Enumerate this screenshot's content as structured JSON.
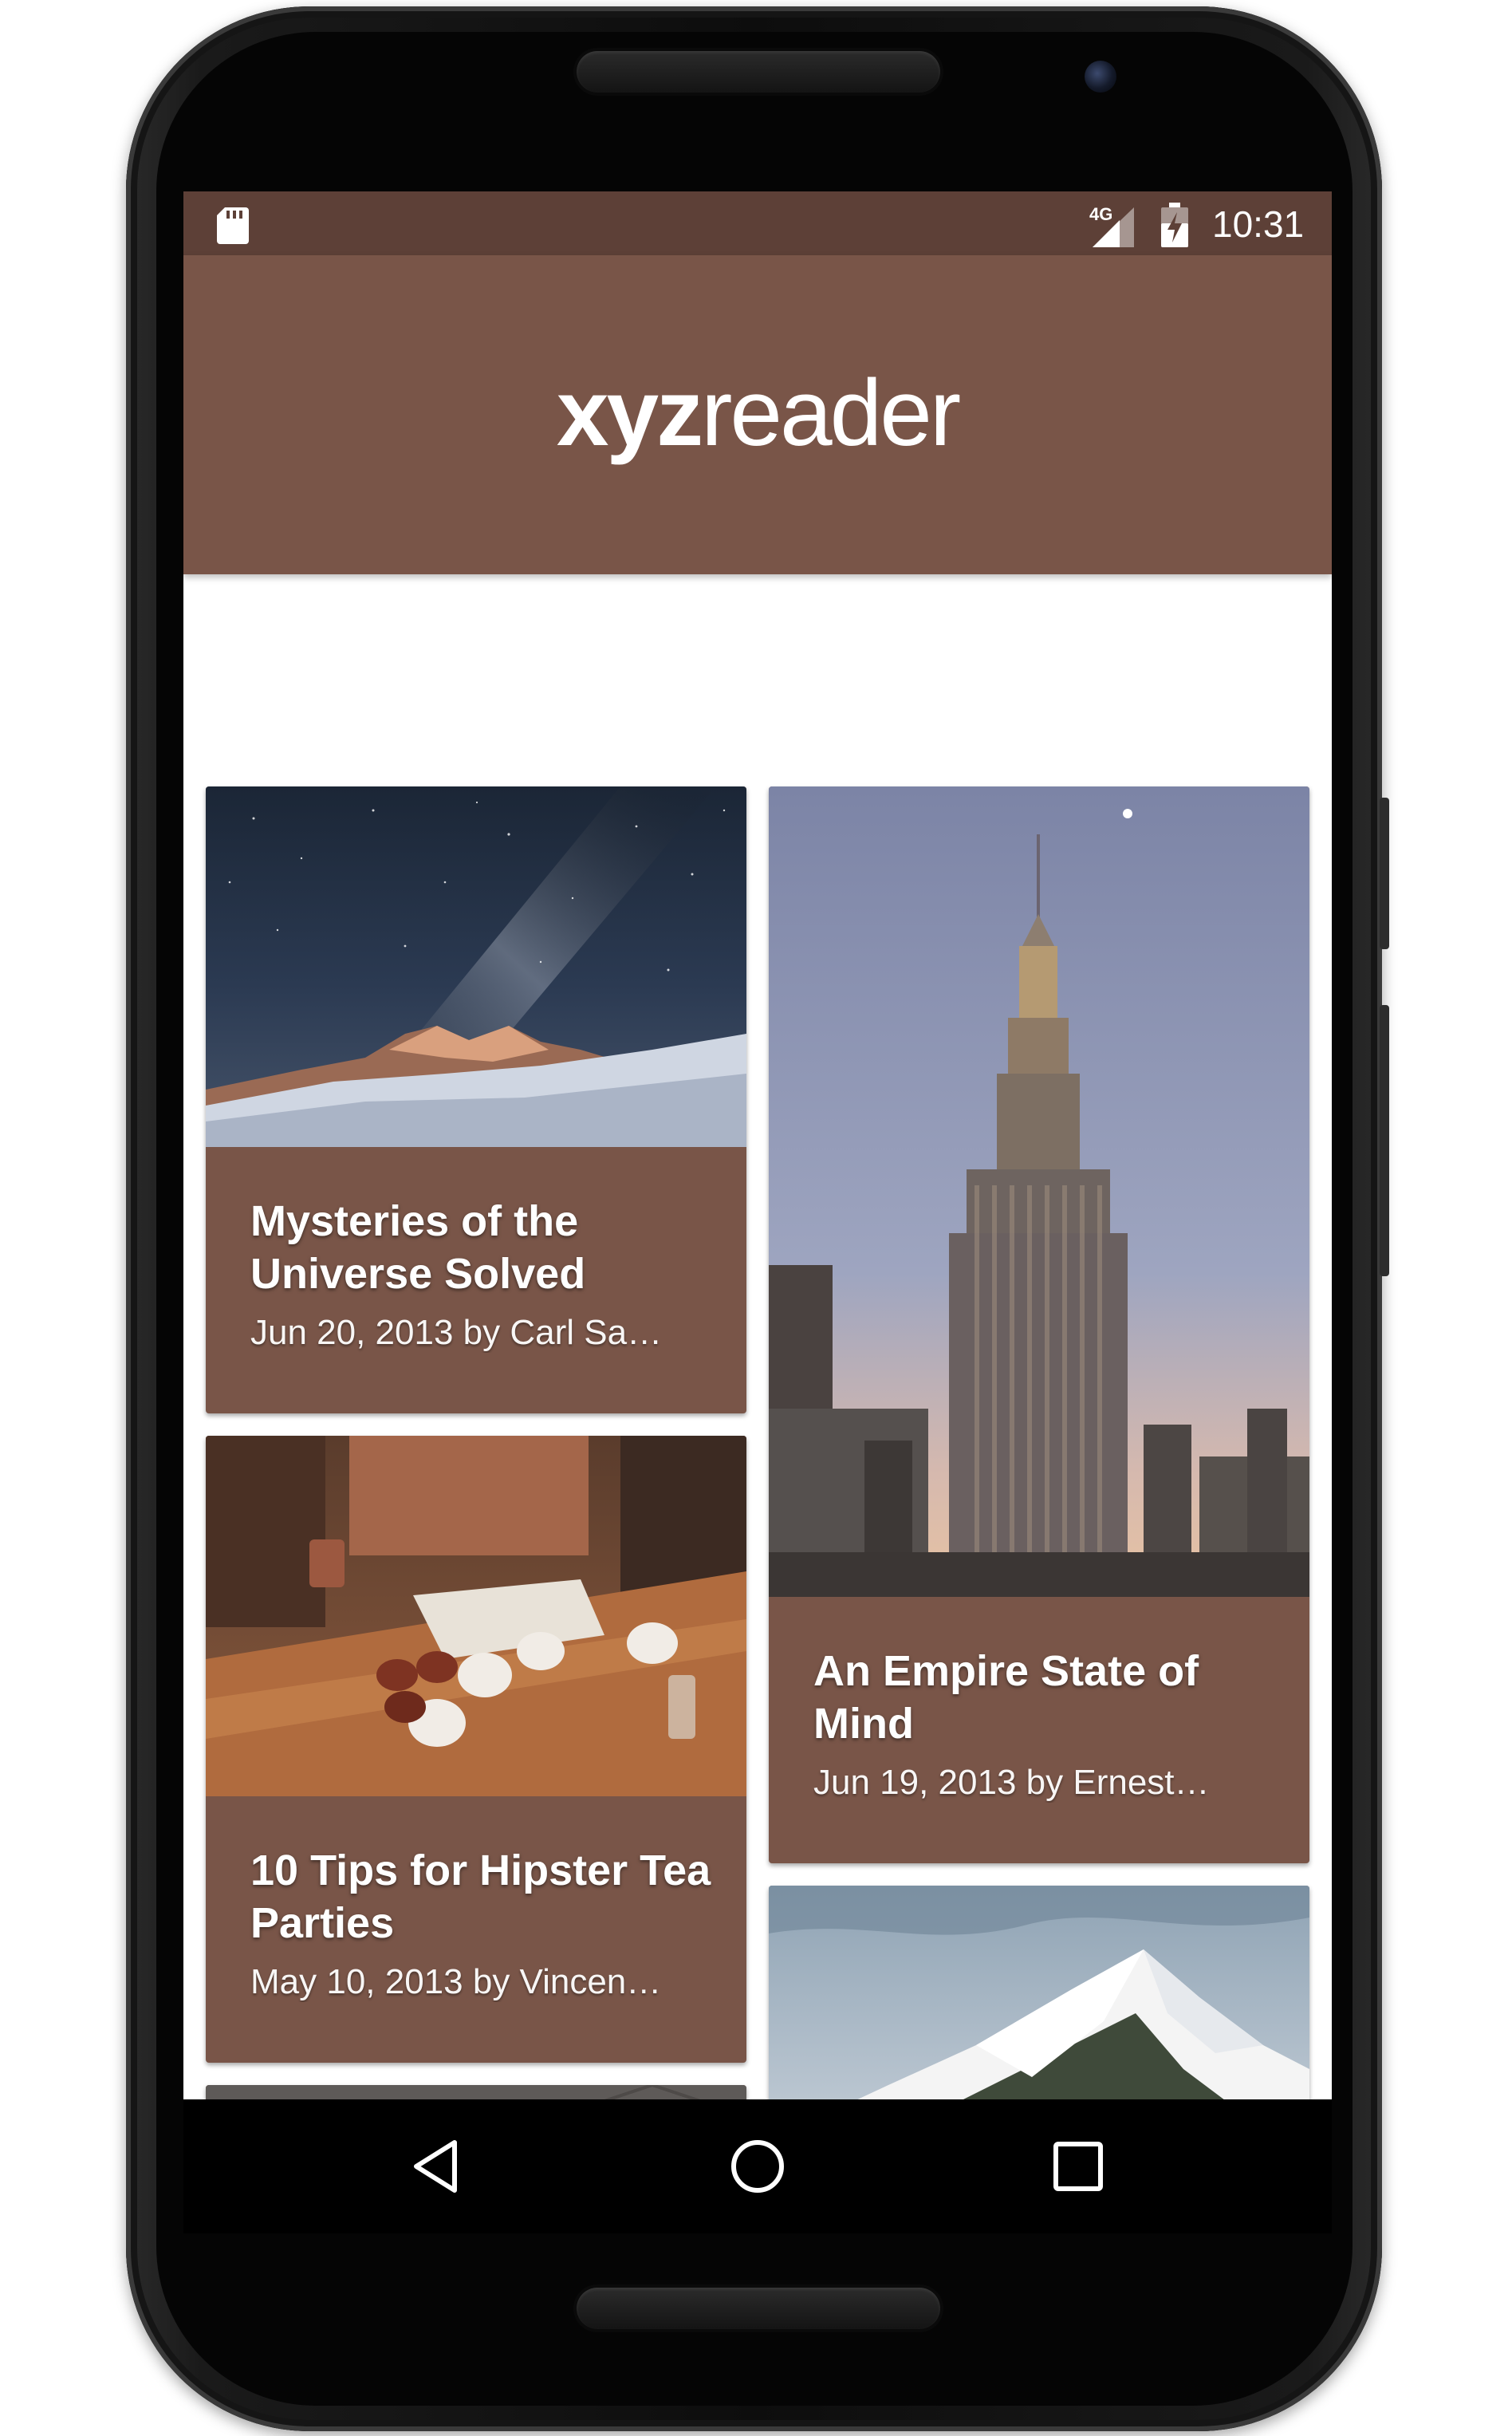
{
  "status_bar": {
    "network": "4G",
    "time": "10:31",
    "icons": [
      "sd-card-icon",
      "signal-icon",
      "battery-icon"
    ]
  },
  "app": {
    "logo_bold": "xyz",
    "logo_regular": "reader"
  },
  "articles": [
    {
      "title": "Mysteries of the Universe Solved",
      "subtitle": "Jun 20, 2013 by Carl Sa…",
      "image": "night-sky-mountain"
    },
    {
      "title": "An Empire State of Mind",
      "subtitle": "Jun 19, 2013 by Ernest…",
      "image": "empire-state-building"
    },
    {
      "title": "10 Tips for Hipster Tea Parties",
      "subtitle": "May 10, 2013 by Vincen…",
      "image": "tea-cups-table"
    },
    {
      "title": "",
      "subtitle": "",
      "image": "snowy-mountain"
    },
    {
      "title": "",
      "subtitle": "",
      "image": "bulldog"
    }
  ],
  "navigation": {
    "buttons": [
      "back-icon",
      "home-icon",
      "recents-icon"
    ]
  },
  "colors": {
    "primary": "#795548",
    "primary_dark": "#5d4037",
    "text_on_primary": "#ffffff"
  }
}
